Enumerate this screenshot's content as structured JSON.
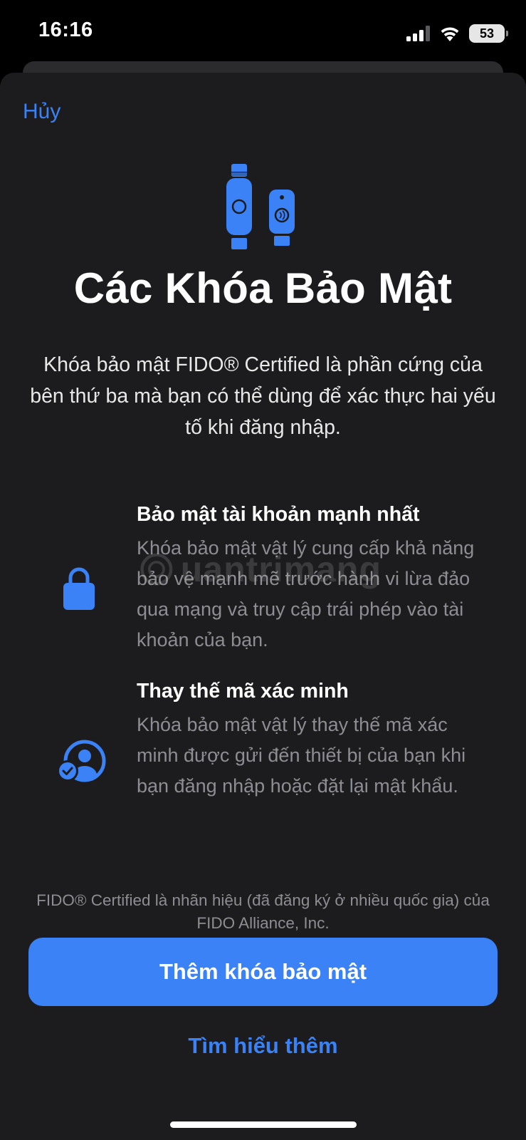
{
  "status_bar": {
    "time": "16:16",
    "battery": "53",
    "icons": [
      "signal-icon",
      "wifi-icon",
      "battery-icon"
    ]
  },
  "sheet": {
    "cancel_label": "Hủy",
    "illustration_icon": "security-keys-icon",
    "title": "Các Khóa Bảo Mật",
    "description": "Khóa bảo mật FIDO® Certified là phần cứng của bên thứ ba mà bạn có thể dùng để xác thực hai yếu tố khi đăng nhập.",
    "features": [
      {
        "icon": "lock-icon",
        "title": "Bảo mật tài khoản mạnh nhất",
        "body": "Khóa bảo mật vật lý cung cấp khả năng bảo vệ mạnh mẽ trước hành vi lừa đảo qua mạng và truy cập trái phép vào tài khoản của bạn."
      },
      {
        "icon": "person-checkmark-icon",
        "title": "Thay thế mã xác minh",
        "body": "Khóa bảo mật vật lý thay thế mã xác minh được gửi đến thiết bị của bạn khi bạn đăng nhập hoặc đặt lại mật khẩu."
      }
    ],
    "watermark": "uantrimang",
    "footnote": "FIDO® Certified là nhãn hiệu (đã đăng ký ở nhiều quốc gia) của FIDO Alliance, Inc.",
    "primary_button_label": "Thêm khóa bảo mật",
    "secondary_link_label": "Tìm hiểu thêm"
  },
  "colors": {
    "accent": "#3a82f6",
    "sheet_background": "#1c1c1e",
    "secondary_text": "#8d8d93"
  }
}
